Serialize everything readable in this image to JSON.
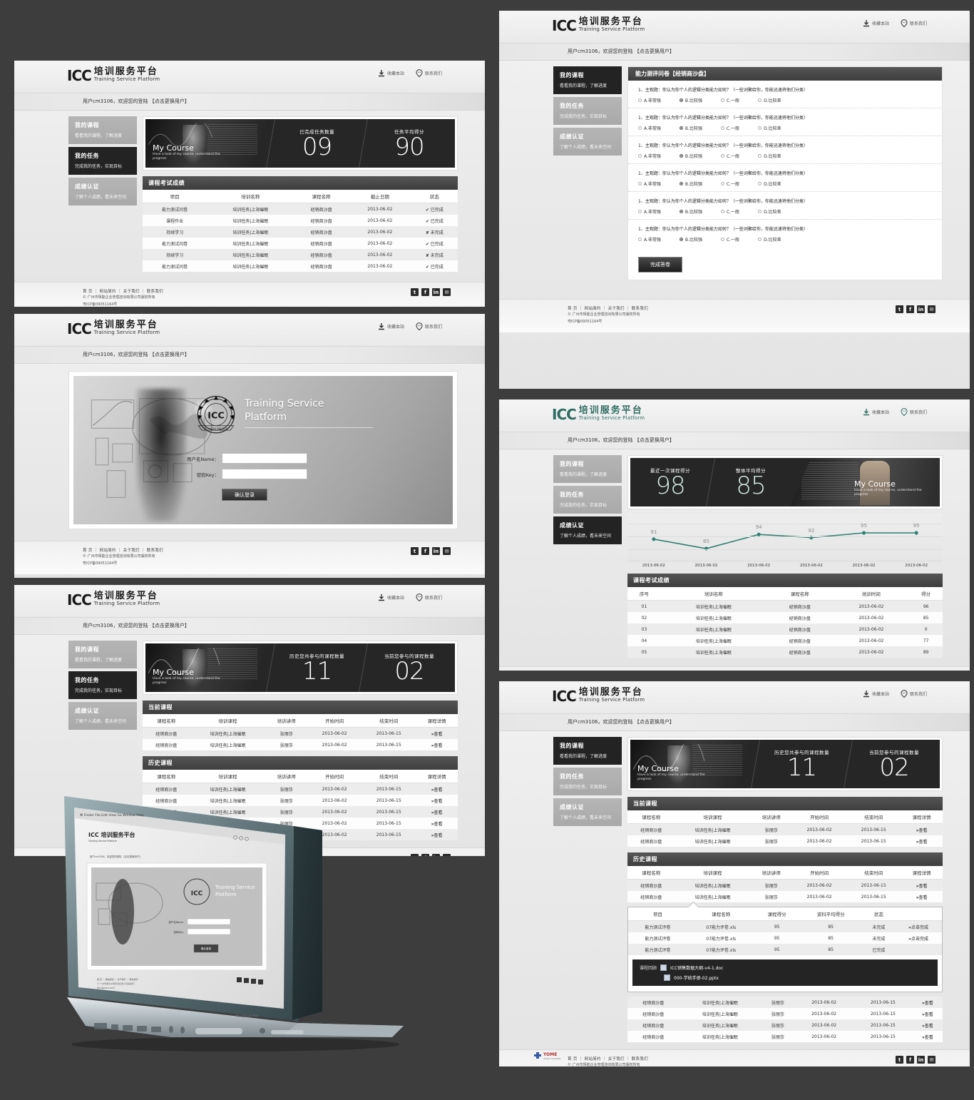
{
  "brand": {
    "mark": "ICC",
    "cn": "培训服务平台",
    "en": "Training Service Platform",
    "accent_gray": "#232323",
    "accent_green": "#2f6d62"
  },
  "header": {
    "bookmark_label": "收藏本站",
    "contact_label": "联系我们",
    "bookmark_icon": "download-icon",
    "contact_icon": "chat-pin-icon"
  },
  "welcome": {
    "text": "用户cm3106，欢迎您的登陆 【点击更换用户】"
  },
  "sidebar": {
    "items": [
      {
        "title": "我的课程",
        "desc": "看看我的课程，了解进度"
      },
      {
        "title": "我的任务",
        "desc": "完成我的任务，实现目标"
      },
      {
        "title": "成绩认证",
        "desc": "了解个人成绩，看未来空间"
      }
    ]
  },
  "hero_course": {
    "title": "My Course",
    "subtitle": "Have a look of my course, understand the progress",
    "stats": [
      {
        "label": "已完成任务数量",
        "value": "09"
      },
      {
        "label": "任务平均得分",
        "value": "90"
      }
    ]
  },
  "hero_mycourse": {
    "title": "My Course",
    "subtitle": "Have a look of my course, understand the progress",
    "stats": [
      {
        "label": "历史您共参与的课程数量",
        "value": "11"
      },
      {
        "label": "当前您参与的课程数量",
        "value": "02"
      }
    ]
  },
  "hero_score": {
    "title": "My Course",
    "subtitle": "Have a look of my course, understand the progress",
    "stats": [
      {
        "label": "最近一次课程得分",
        "value": "98"
      },
      {
        "label": "整体平均得分",
        "value": "85"
      }
    ]
  },
  "exam_table": {
    "section_title": "课程考试成绩",
    "columns": [
      "项目",
      "培训名称",
      "课程名称",
      "截止日期",
      "状态"
    ],
    "rows": [
      [
        "能力测试问卷",
        "培训任务|上海催眠",
        "经销商沙盘",
        "2013-06-02",
        "✔ 已完成"
      ],
      [
        "课程作业",
        "培训任务|上海催眠",
        "经销商沙盘",
        "2013-06-02",
        "✔ 已完成"
      ],
      [
        "持续学习",
        "培训任务|上海催眠",
        "经销商沙盘",
        "2013-06-02",
        "✘ 未完成"
      ],
      [
        "能力测试问卷",
        "培训任务|上海催眠",
        "经销商沙盘",
        "2013-06-02",
        "✔ 已完成"
      ],
      [
        "持续学习",
        "培训任务|上海催眠",
        "经销商沙盘",
        "2013-06-02",
        "✘ 未完成"
      ],
      [
        "能力测试问卷",
        "培训任务|上海催眠",
        "经销商沙盘",
        "2013-06-02",
        "✔ 已完成"
      ]
    ]
  },
  "login": {
    "title_line1": "Training Service",
    "title_line2": "Platform",
    "seal_text": "ICC",
    "name_label": "用户名Name：",
    "key_label": "密码Key：",
    "name_value": "",
    "key_value": "",
    "submit_label": "确认登录"
  },
  "current_courses": {
    "section_title": "当前课程",
    "columns": [
      "课程名称",
      "培训课程",
      "培训讲师",
      "开始时间",
      "结束时间",
      "课程详情"
    ],
    "rows": [
      [
        "经销商沙盘",
        "培训任务|上海催眠",
        "张丽莎",
        "2013-06-02",
        "2013-06-15",
        "查看"
      ],
      [
        "经销商沙盘",
        "培训任务|上海催眠",
        "张丽莎",
        "2013-06-02",
        "2013-06-15",
        "查看"
      ]
    ]
  },
  "history_courses": {
    "section_title": "历史课程",
    "columns": [
      "课程名称",
      "培训课程",
      "培训讲师",
      "开始时间",
      "结束时间",
      "课程详情"
    ],
    "rows": [
      [
        "经销商沙盘",
        "培训任务|上海催眠",
        "张丽莎",
        "2013-06-02",
        "2013-06-15",
        "查看"
      ],
      [
        "经销商沙盘",
        "培训任务|上海催眠",
        "张丽莎",
        "2013-06-02",
        "2013-06-15",
        "查看"
      ],
      [
        "经销商沙盘",
        "培训任务|上海催眠",
        "张丽莎",
        "2013-06-02",
        "2013-06-15",
        "查看"
      ],
      [
        "经销商沙盘",
        "培训任务|上海催眠",
        "张丽莎",
        "2013-06-02",
        "2013-06-15",
        "查看"
      ],
      [
        "经销商沙盘",
        "培训任务|上海催眠",
        "张丽莎",
        "2013-06-02",
        "2013-06-15",
        "查看"
      ]
    ],
    "rows_top": [
      [
        "经销商沙盘",
        "培训任务|上海催眠",
        "张丽莎",
        "2013-06-02",
        "2013-06-15",
        "查看"
      ],
      [
        "经销商沙盘",
        "培训任务|上海催眠",
        "张丽莎",
        "2013-06-02",
        "2013-06-15",
        "查看"
      ]
    ],
    "rows_bottom": [
      [
        "经销商沙盘",
        "培训任务|上海催眠",
        "张丽莎",
        "2013-06-02",
        "2013-06-15",
        "查看"
      ],
      [
        "经销商沙盘",
        "培训任务|上海催眠",
        "张丽莎",
        "2013-06-02",
        "2013-06-15",
        "查看"
      ],
      [
        "经销商沙盘",
        "培训任务|上海催眠",
        "张丽莎",
        "2013-06-02",
        "2013-06-15",
        "查看"
      ],
      [
        "经销商沙盘",
        "培训任务|上海催眠",
        "张丽莎",
        "2013-06-02",
        "2013-06-15",
        "查看"
      ]
    ]
  },
  "detail_expand": {
    "columns": [
      "项目",
      "课程名称",
      "课程得分",
      "该科平均得分",
      "状态",
      ""
    ],
    "rows": [
      [
        "能力测试评卷",
        "07能力评卷.xls",
        "95",
        "85",
        "未完成",
        "点击完成"
      ],
      [
        "能力测试评卷",
        "07能力评卷.xls",
        "95",
        "85",
        "未完成",
        "点击完成"
      ],
      [
        "能力测试评卷",
        "07能力评卷.xls",
        "95",
        "85",
        "已完成",
        ""
      ]
    ],
    "files_label": "课程回顾",
    "files": [
      "ICC销售数据大纲-v4-1.doc",
      "000-学统手册-02.pptx"
    ]
  },
  "quiz": {
    "section_title": "能力测评问卷【经销商沙盘】",
    "questions": [
      {
        "text": "1、主观题：你认为你个人的逻辑分类能力如何？（一些词聚给你，你能迅速将他们分类）",
        "options": [
          "A.非常强",
          "B.比较强",
          "C.一般",
          "D.比较差"
        ],
        "selected": 1
      },
      {
        "text": "1、主观题：你认为你个人的逻辑分类能力如何？（一些词聚给你，你能迅速将他们分类）",
        "options": [
          "A.非常强",
          "B.比较强",
          "C.一般",
          "D.比较差"
        ],
        "selected": 1
      },
      {
        "text": "1、主观题：你认为你个人的逻辑分类能力如何？（一些词聚给你，你能迅速将他们分类）",
        "options": [
          "A.非常强",
          "B.比较强",
          "C.一般",
          "D.比较差"
        ],
        "selected": 1
      },
      {
        "text": "1、主观题：你认为你个人的逻辑分类能力如何？（一些词聚给你，你能迅速将他们分类）",
        "options": [
          "A.非常强",
          "B.比较强",
          "C.一般",
          "D.比较差"
        ],
        "selected": 1
      },
      {
        "text": "1、主观题：你认为你个人的逻辑分类能力如何？（一些词聚给你，你能迅速将他们分类）",
        "options": [
          "A.非常强",
          "B.比较强",
          "C.一般",
          "D.比较差"
        ],
        "selected": 1
      },
      {
        "text": "1、主观题：你认为你个人的逻辑分类能力如何？（一些词聚给你，你能迅速将他们分类）",
        "options": [
          "A.非常强",
          "B.比较强",
          "C.一般",
          "D.比较差"
        ],
        "selected": 1
      }
    ],
    "submit_label": "完成答卷"
  },
  "score_table": {
    "section_title": "课程考试成绩",
    "columns": [
      "序号",
      "培训名称",
      "课程名称",
      "培训时间",
      "得分"
    ],
    "rows": [
      [
        "01",
        "培训任务|上海催眠",
        "经销商沙盘",
        "2013-06-02",
        "96"
      ],
      [
        "02",
        "培训任务|上海催眠",
        "经销商沙盘",
        "2013-06-02",
        "85"
      ],
      [
        "03",
        "培训任务|上海催眠",
        "经销商沙盘",
        "2013-06-02",
        "0"
      ],
      [
        "04",
        "培训任务|上海催眠",
        "经销商沙盘",
        "2013-06-02",
        "77"
      ],
      [
        "05",
        "培训任务|上海催眠",
        "经销商沙盘",
        "2013-06-02",
        "89"
      ]
    ]
  },
  "chart_data": {
    "type": "line",
    "title": "",
    "x": [
      "2013-06-02",
      "2013-06-02",
      "2013-06-02",
      "2013-06-02",
      "2013-06-02",
      "2013-06-02"
    ],
    "values": [
      91,
      85,
      94,
      92,
      95,
      95
    ],
    "line_color": "#2f8073",
    "ylim": [
      80,
      100
    ],
    "grid": true,
    "xlabel": "",
    "ylabel": ""
  },
  "footer": {
    "nav": "首 页 ｜ 网站简约 ｜ 关于我们 ｜ 联系我们",
    "copy1": "© 广州市辉能企业管理咨询有限公司版权所有",
    "copy2": "粤ICP备09051164号",
    "social": [
      "t",
      "f",
      "in",
      "✉"
    ]
  },
  "laptop": {
    "model_label": "MacBook Pro",
    "menubar": [
      "Finder",
      "File",
      "Edit",
      "View",
      "Go",
      "Window",
      "Help"
    ]
  }
}
